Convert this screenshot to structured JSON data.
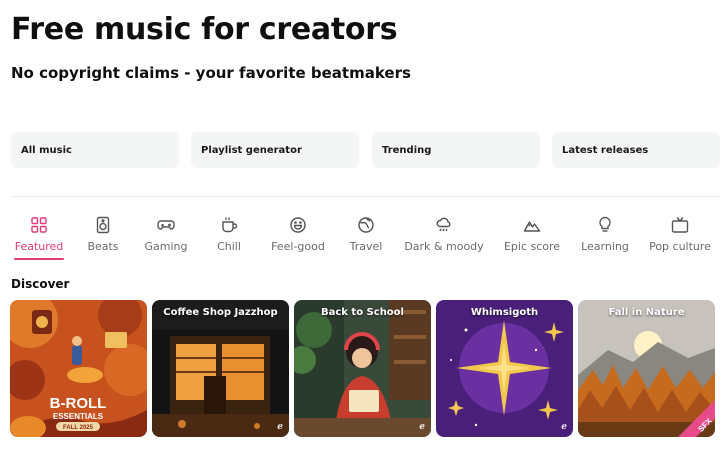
{
  "hero": {
    "title": "Free music for creators",
    "subtitle": "No copyright claims - your favorite beatmakers"
  },
  "quick_links": [
    {
      "label": "All music"
    },
    {
      "label": "Playlist generator"
    },
    {
      "label": "Trending"
    },
    {
      "label": "Latest releases"
    }
  ],
  "categories": [
    {
      "label": "Featured",
      "icon": "grid-icon",
      "active": true
    },
    {
      "label": "Beats",
      "icon": "speaker-icon"
    },
    {
      "label": "Gaming",
      "icon": "gamepad-icon"
    },
    {
      "label": "Chill",
      "icon": "coffee-cup-icon"
    },
    {
      "label": "Feel-good",
      "icon": "smiley-icon"
    },
    {
      "label": "Travel",
      "icon": "globe-icon"
    },
    {
      "label": "Dark & moody",
      "icon": "storm-cloud-icon"
    },
    {
      "label": "Epic score",
      "icon": "mountain-icon"
    },
    {
      "label": "Learning",
      "icon": "lightbulb-icon"
    },
    {
      "label": "Pop culture",
      "icon": "tv-icon"
    }
  ],
  "section": {
    "discover": "Discover"
  },
  "cards": [
    {
      "title": "",
      "art_text_1": "B-ROLL",
      "art_text_2": "ESSENTIALS",
      "art_text_3": "FALL 2025",
      "palette": "autumn"
    },
    {
      "title": "Coffee Shop Jazzhop",
      "palette": "night-shop"
    },
    {
      "title": "Back to School",
      "palette": "study"
    },
    {
      "title": "Whimsigoth",
      "palette": "purple-stars"
    },
    {
      "title": "Fall in Nature",
      "badge": "SFX",
      "palette": "forest"
    }
  ],
  "colors": {
    "accent": "#e23a78",
    "chip_bg": "#f4f5f5",
    "muted": "#6a6a6a"
  }
}
